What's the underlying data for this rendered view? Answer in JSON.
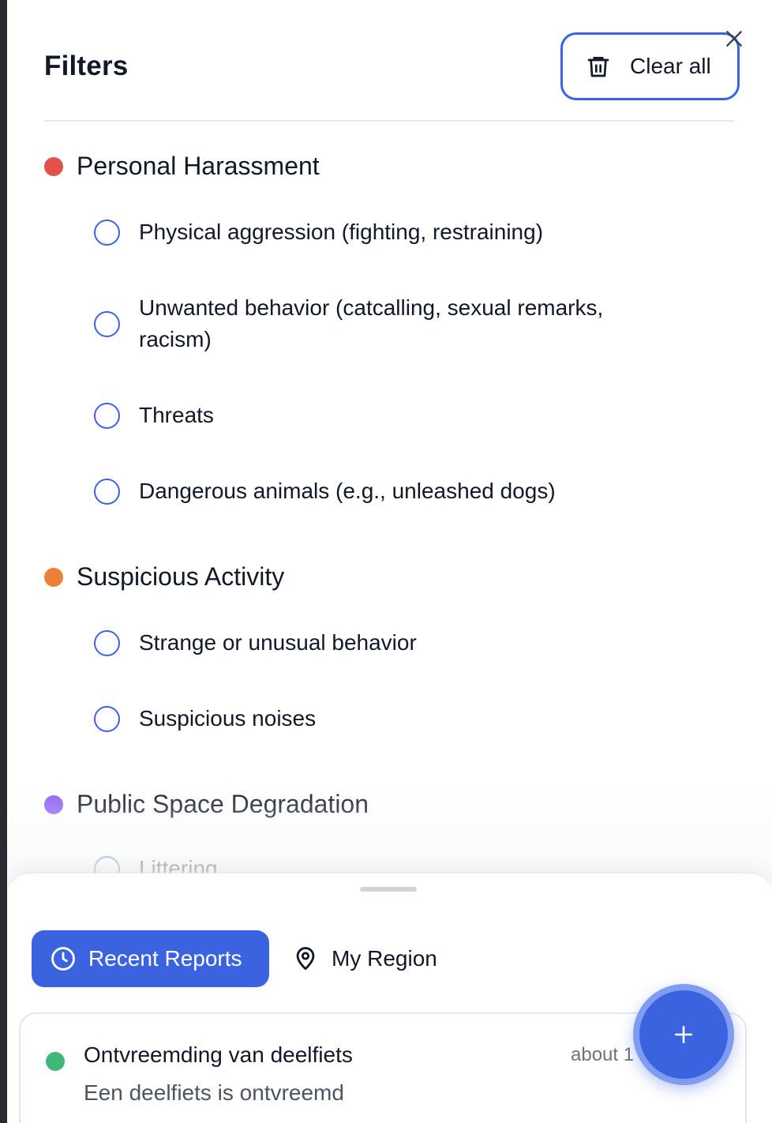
{
  "header": {
    "title": "Filters",
    "clear_all_label": "Clear all"
  },
  "categories": [
    {
      "label": "Personal Harassment",
      "color": "#e0524a",
      "options": [
        "Physical aggression (fighting, restraining)",
        "Unwanted behavior (catcalling, sexual remarks, racism)",
        "Threats",
        "Dangerous animals (e.g., unleashed dogs)"
      ]
    },
    {
      "label": "Suspicious Activity",
      "color": "#ee7f38",
      "options": [
        "Strange or unusual behavior",
        "Suspicious noises"
      ]
    },
    {
      "label": "Public Space Degradation",
      "color": "#8b5cf6",
      "options": [
        "Littering"
      ]
    }
  ],
  "tabs": {
    "recent_label": "Recent Reports",
    "region_label": "My Region"
  },
  "report": {
    "title": "Ontvreemding van deelfiets",
    "time": "about 1",
    "description": "Een deelfiets is ontvreemd",
    "status_color": "#3fb87a"
  },
  "icons": {
    "clear": "trash-icon",
    "close": "close-icon",
    "recent": "clock-icon",
    "region": "map-pin-icon",
    "fab": "plus-icon"
  },
  "accent_color": "#3b63e0"
}
